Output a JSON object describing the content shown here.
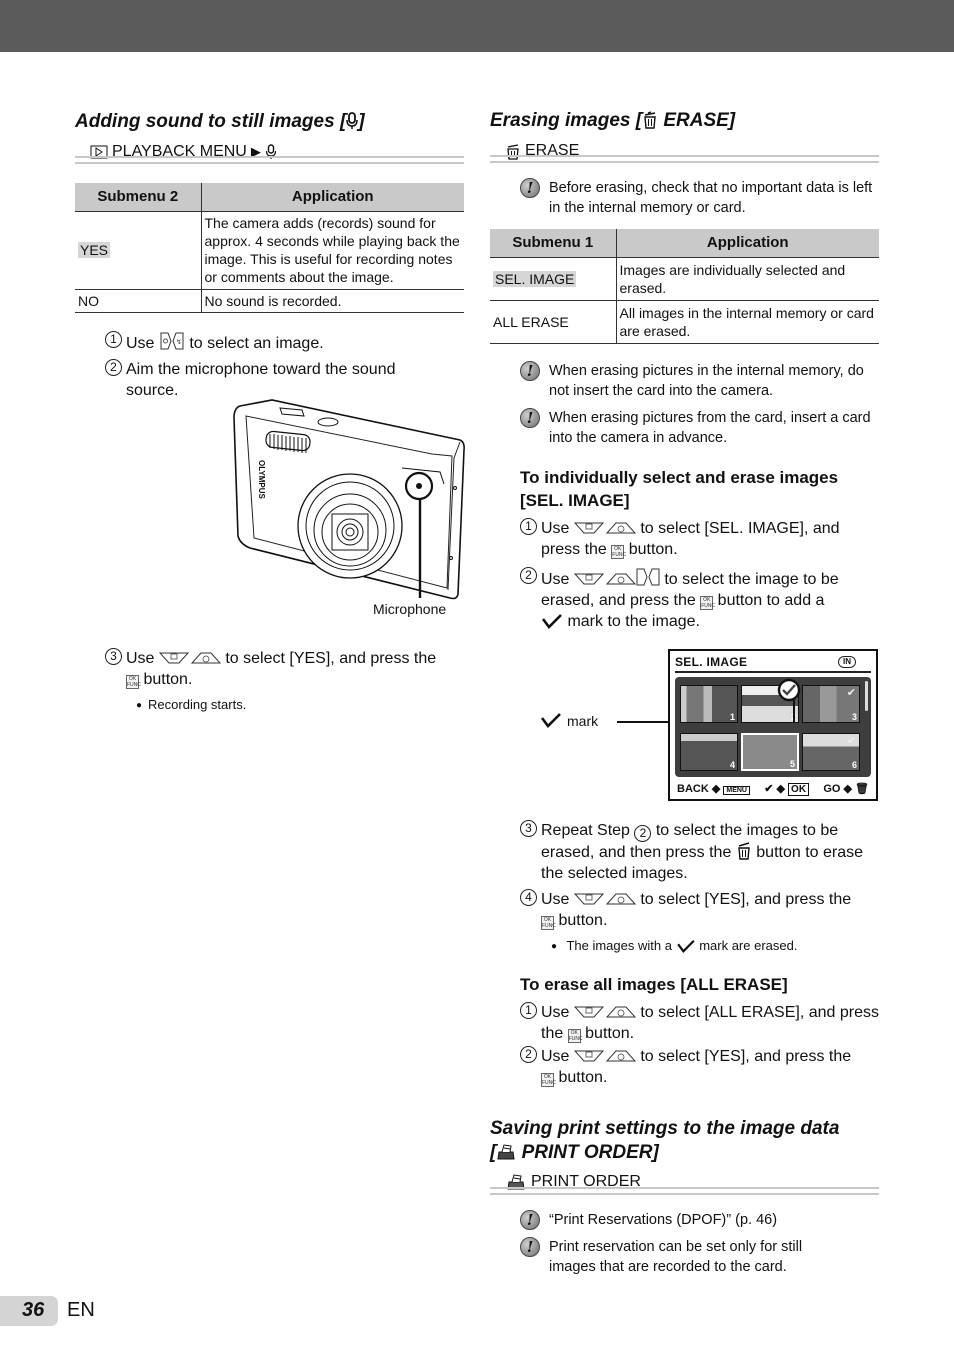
{
  "page": {
    "number": "36",
    "language": "EN",
    "header_bar_color": "#5a5a5a"
  },
  "left": {
    "section_title": "Adding sound to still images [",
    "section_title_icon": "microphone-icon",
    "section_title_end": "]",
    "menu_path": {
      "icon": "playback-icon",
      "label": "PLAYBACK MENU",
      "separator": "▶",
      "end_icon": "microphone-icon"
    },
    "table": {
      "headers": [
        "Submenu 2",
        "Application"
      ],
      "rows": [
        {
          "submenu": "YES",
          "application": "The camera adds (records) sound for approx. 4 seconds while playing back the image. This is useful for recording notes or comments about the image."
        },
        {
          "submenu": "NO",
          "application": "No sound is recorded."
        }
      ]
    },
    "steps": [
      {
        "num": "1",
        "pre": "Use",
        "icons": [
          "left-right-arrow-icon"
        ],
        "post": "to select an image."
      },
      {
        "num": "2",
        "text": "Aim the microphone toward the sound source."
      },
      {
        "num": "3",
        "pre": "Use",
        "icons": [
          "up-down-arrow-icon"
        ],
        "post": "to select [YES], and press the",
        "post2": "button."
      }
    ],
    "figure_caption": "Microphone",
    "camera_brand": "OLYMPUS",
    "bullet": "Recording starts."
  },
  "right": {
    "section_title": "Erasing images [",
    "section_title_icon": "trash-icon",
    "section_title_end": "ERASE]",
    "menu_path": {
      "icon": "trash-icon",
      "label": "ERASE"
    },
    "note_top": "Before erasing, check that no important data is left in the internal memory or card.",
    "table": {
      "headers": [
        "Submenu 1",
        "Application"
      ],
      "rows": [
        {
          "submenu": "SEL. IMAGE",
          "application": "Images are individually selected and erased."
        },
        {
          "submenu": "ALL ERASE",
          "application": "All images in the internal memory or card are erased."
        }
      ]
    },
    "notes": [
      "When erasing pictures in the internal memory, do not insert the card into the camera.",
      "When erasing pictures from the card, insert a card into the camera in advance."
    ],
    "sel_image": {
      "heading": "To individually select and erase images [SEL. IMAGE]",
      "step1_pre": "Use",
      "step1_post": "to select [SEL. IMAGE], and press the",
      "step1_end": "button.",
      "step2_pre": "Use",
      "step2_post": "to select the image to be erased, and press the",
      "step2_mid": "button to add a",
      "step2_end": "mark to the image.",
      "step3_pre": "Repeat Step",
      "step3_ref": "2",
      "step3_post": "to select the images to be erased, and then press the",
      "step3_end": "button to erase the selected images.",
      "step4_pre": "Use",
      "step4_post": "to select [YES], and press the",
      "step4_end": "button.",
      "bullet_pre": "The images with a",
      "bullet_post": "mark are erased."
    },
    "lcd": {
      "title": "SEL. IMAGE",
      "memory_badge": "IN",
      "mark_label": "mark",
      "thumbnails": [
        {
          "num": "1",
          "checked": false
        },
        {
          "num": "2",
          "checked": true
        },
        {
          "num": "3",
          "checked": true
        },
        {
          "num": "4",
          "checked": false
        },
        {
          "num": "5",
          "checked": false,
          "selected": true
        },
        {
          "num": "6",
          "checked": true
        }
      ],
      "footer_back": "BACK",
      "footer_back_key": "MENU",
      "footer_ok": "OK",
      "footer_go": "GO"
    },
    "all_erase": {
      "heading": "To erase all images [ALL ERASE]",
      "step1_pre": "Use",
      "step1_post": "to select [ALL ERASE], and press the",
      "step1_end": "button.",
      "step2_pre": "Use",
      "step2_post": "to select [YES], and press the",
      "step2_end": "button."
    },
    "print_order": {
      "title_line1": "Saving print settings to the image data",
      "title_line2_pre": "[",
      "title_line2": "PRINT ORDER]",
      "menu_label": "PRINT ORDER",
      "notes": [
        "“Print Reservations (DPOF)” (p. 46)",
        "Print reservation can be set only for still images that are recorded to the card."
      ]
    }
  }
}
